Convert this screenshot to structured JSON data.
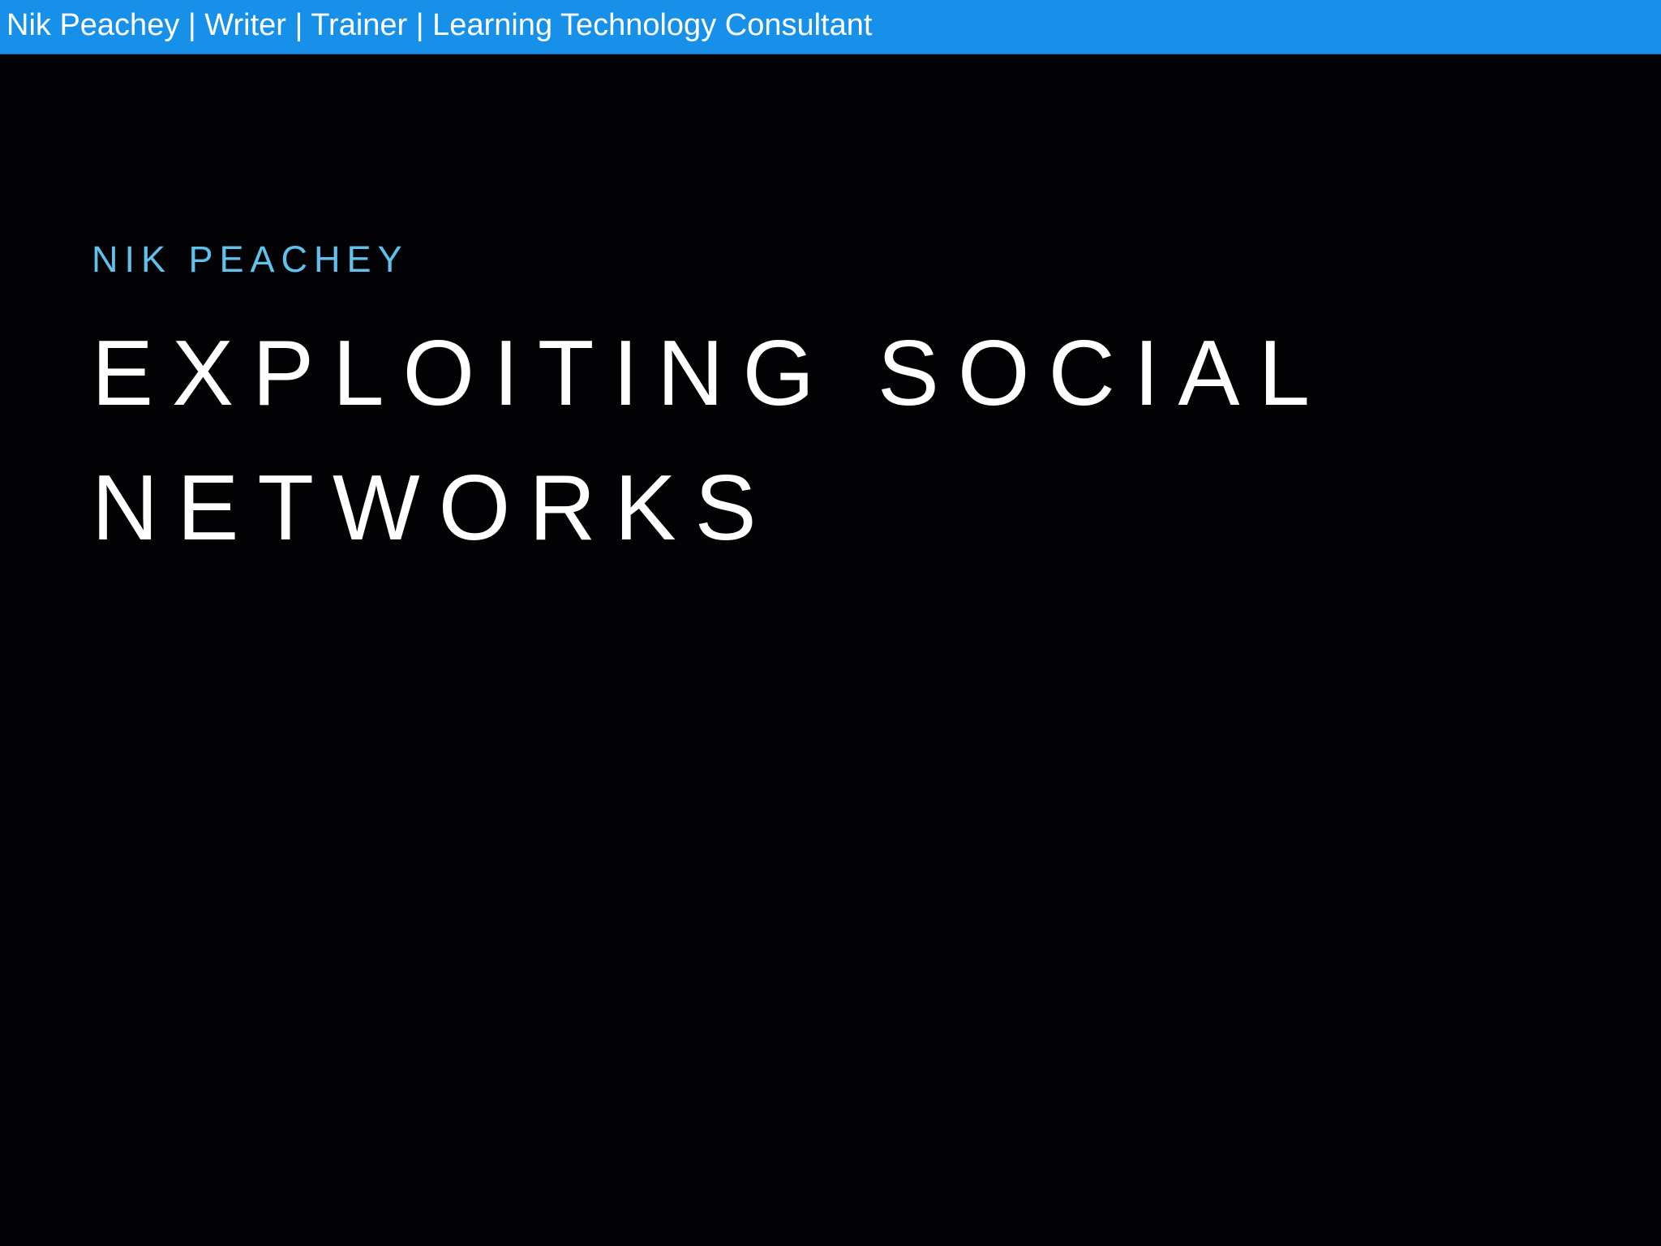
{
  "banner": {
    "text": "Nik Peachey | Writer | Trainer | Learning Technology Consultant",
    "background_color": "#1690e8"
  },
  "slide": {
    "author": "NIK PEACHEY",
    "author_color": "#5fc1ec",
    "title_lines": [
      "EXPLOITING SOCIAL",
      "NETWORKS"
    ],
    "background_color": "#030305"
  }
}
